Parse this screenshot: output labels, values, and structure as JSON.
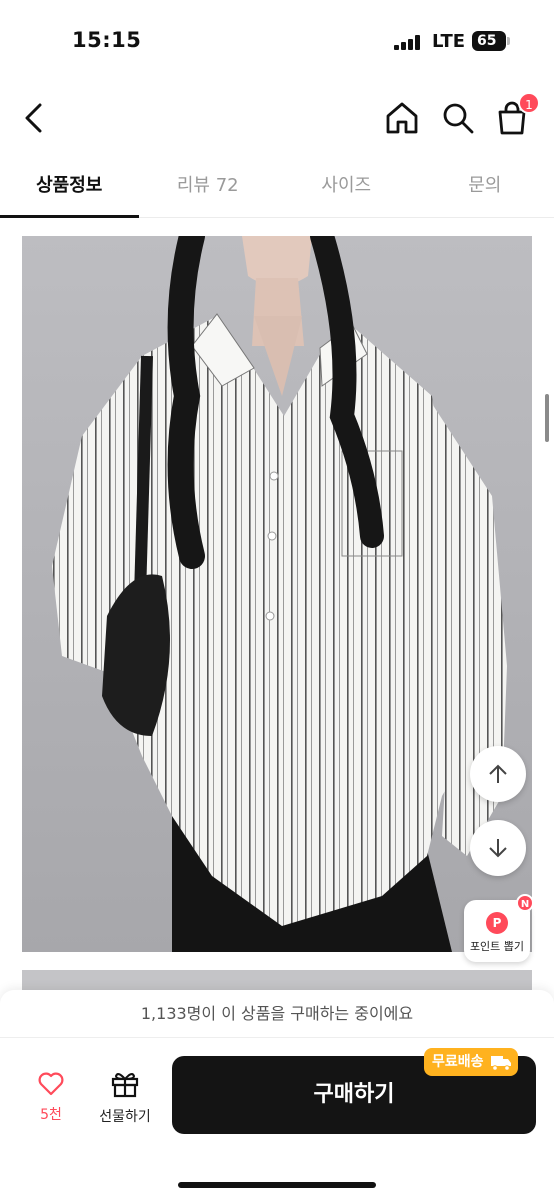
{
  "status_bar": {
    "time": "15:15",
    "network": "LTE",
    "battery": "65"
  },
  "header": {
    "back_icon": "chevron-left-icon",
    "home_icon": "home-icon",
    "search_icon": "search-icon",
    "cart_icon": "shopping-bag-icon",
    "cart_badge": "1"
  },
  "tabs": [
    {
      "label": "상품정보",
      "active": true
    },
    {
      "label": "리뷰 72",
      "active": false
    },
    {
      "label": "사이즈",
      "active": false
    },
    {
      "label": "문의",
      "active": false
    }
  ],
  "floating": {
    "scroll_up_icon": "arrow-up-icon",
    "scroll_down_icon": "arrow-down-icon",
    "point_icon_letter": "P",
    "point_new_badge": "N",
    "point_label": "포인트 뽑기"
  },
  "bottom_bar": {
    "buyers_text": "1,133명이 이 상품을 구매하는 중이에요",
    "like_count": "5천",
    "gift_label": "선물하기",
    "buy_label": "구매하기",
    "free_shipping_badge": "무료배송"
  },
  "colors": {
    "accent": "#ff4a5a",
    "buy_button": "#141414",
    "free_shipping": "#ffb21f"
  }
}
